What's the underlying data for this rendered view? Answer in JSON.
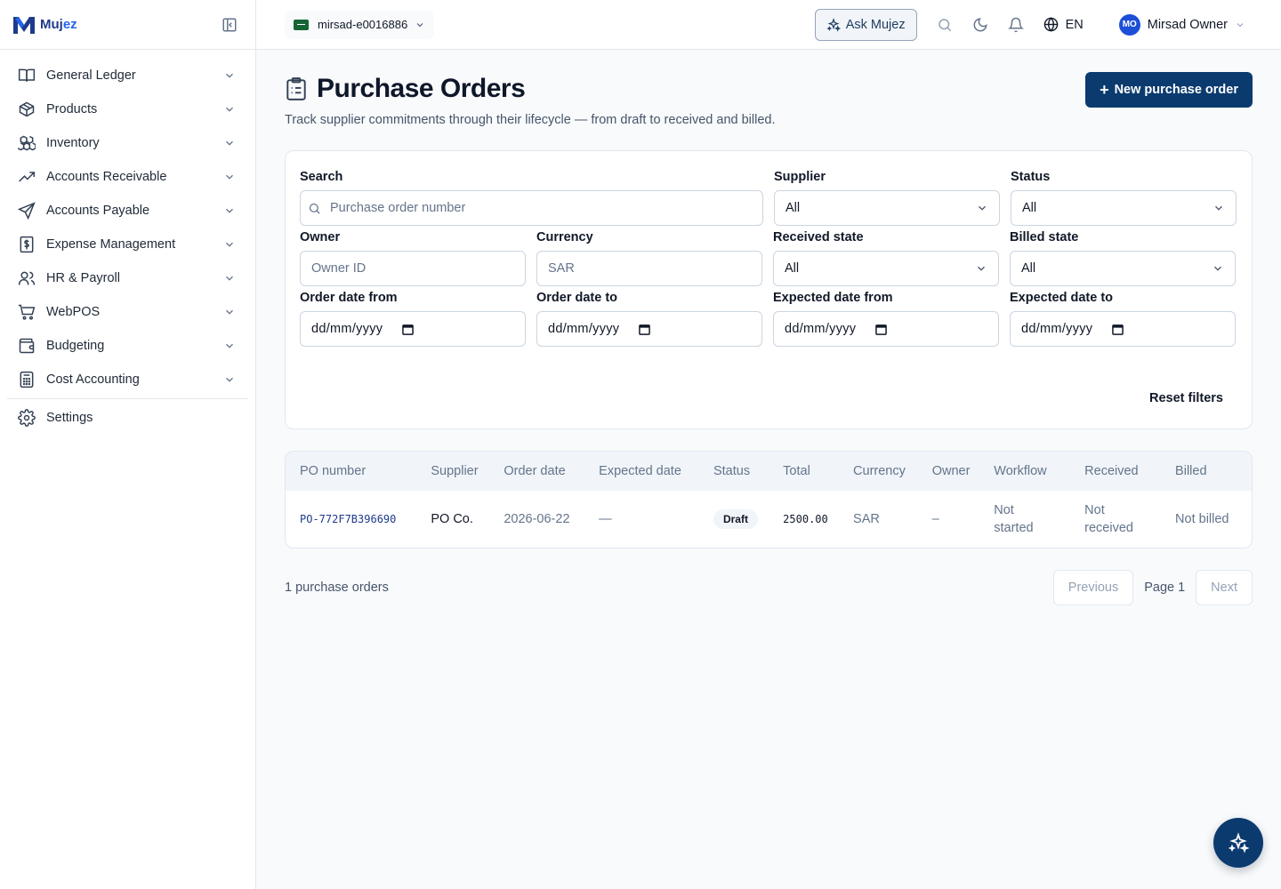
{
  "brand": {
    "name_main": "Muj",
    "name_accent": "ez"
  },
  "sidebar": {
    "items": [
      {
        "label": "General Ledger",
        "icon": "book-open-icon"
      },
      {
        "label": "Products",
        "icon": "package-icon"
      },
      {
        "label": "Inventory",
        "icon": "boxes-icon"
      },
      {
        "label": "Accounts Receivable",
        "icon": "trending-up-icon"
      },
      {
        "label": "Accounts Payable",
        "icon": "send-icon"
      },
      {
        "label": "Expense Management",
        "icon": "receipt-dollar-icon"
      },
      {
        "label": "HR & Payroll",
        "icon": "users-icon"
      },
      {
        "label": "WebPOS",
        "icon": "shopping-cart-icon"
      },
      {
        "label": "Budgeting",
        "icon": "wallet-icon"
      },
      {
        "label": "Cost Accounting",
        "icon": "calculator-icon"
      }
    ],
    "settings_label": "Settings"
  },
  "topbar": {
    "company": "mirsad-e0016886",
    "ask_label": "Ask Mujez",
    "language": "EN",
    "user_initials": "MO",
    "user_name": "Mirsad Owner"
  },
  "page": {
    "title": "Purchase Orders",
    "subtitle": "Track supplier commitments through their lifecycle — from draft to received and billed.",
    "new_button": "New purchase order"
  },
  "filters": {
    "search": {
      "label": "Search",
      "placeholder": "Purchase order number"
    },
    "supplier": {
      "label": "Supplier",
      "value": "All"
    },
    "status": {
      "label": "Status",
      "value": "All"
    },
    "owner": {
      "label": "Owner",
      "placeholder": "Owner ID"
    },
    "currency": {
      "label": "Currency",
      "placeholder": "SAR"
    },
    "received_state": {
      "label": "Received state",
      "value": "All"
    },
    "billed_state": {
      "label": "Billed state",
      "value": "All"
    },
    "order_date_from": {
      "label": "Order date from",
      "value": "dd/mm/yyyy"
    },
    "order_date_to": {
      "label": "Order date to",
      "value": "dd/mm/yyyy"
    },
    "expected_date_from": {
      "label": "Expected date from",
      "value": "dd/mm/yyyy"
    },
    "expected_date_to": {
      "label": "Expected date to",
      "value": "dd/mm/yyyy"
    },
    "reset_label": "Reset filters"
  },
  "table": {
    "columns": [
      "PO number",
      "Supplier",
      "Order date",
      "Expected date",
      "Status",
      "Total",
      "Currency",
      "Owner",
      "Workflow",
      "Received",
      "Billed"
    ],
    "rows": [
      {
        "po_number": "PO-772F7B396690",
        "supplier": "PO Co.",
        "order_date": "2026-06-22",
        "expected_date": "—",
        "status": "Draft",
        "total": "2500.00",
        "currency": "SAR",
        "owner": "–",
        "workflow": "Not started",
        "received": "Not received",
        "billed": "Not billed"
      }
    ]
  },
  "pagination": {
    "count_text": "1 purchase orders",
    "previous": "Previous",
    "page_text": "Page 1",
    "next": "Next"
  },
  "colors": {
    "primary": "#0b3a6e",
    "accent": "#2563eb",
    "avatar": "#1d4ed8"
  }
}
